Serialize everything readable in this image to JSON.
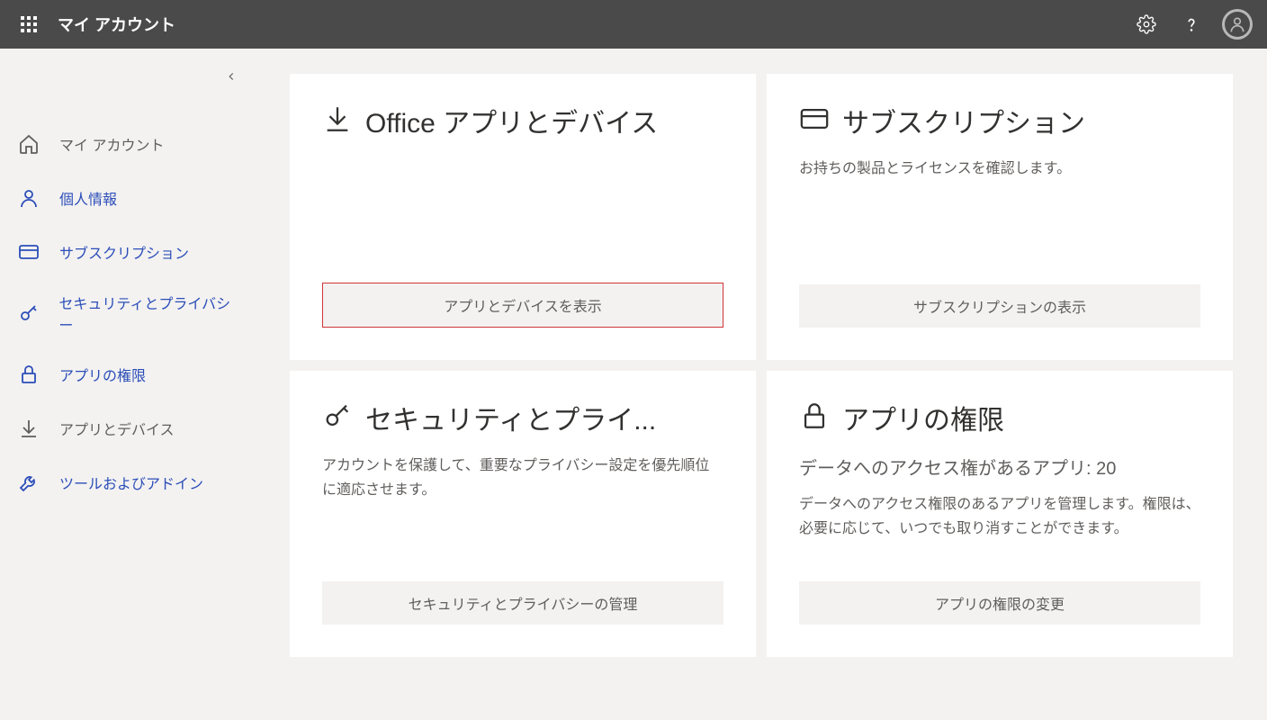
{
  "header": {
    "title": "マイ アカウント"
  },
  "sidebar": {
    "items": [
      {
        "label": "マイ アカウント",
        "link": false
      },
      {
        "label": "個人情報",
        "link": true
      },
      {
        "label": "サブスクリプション",
        "link": true
      },
      {
        "label": "セキュリティとプライバシー",
        "link": true
      },
      {
        "label": "アプリの権限",
        "link": true
      },
      {
        "label": "アプリとデバイス",
        "link": false
      },
      {
        "label": "ツールおよびアドイン",
        "link": true
      }
    ]
  },
  "cards": {
    "office": {
      "title": "Office アプリとデバイス",
      "button": "アプリとデバイスを表示"
    },
    "subscription": {
      "title": "サブスクリプション",
      "desc": "お持ちの製品とライセンスを確認します。",
      "button": "サブスクリプションの表示"
    },
    "security": {
      "title": "セキュリティとプライ...",
      "desc": "アカウントを保護して、重要なプライバシー設定を優先順位に適応させます。",
      "button": "セキュリティとプライバシーの管理"
    },
    "permissions": {
      "title": "アプリの権限",
      "access_count": "データへのアクセス権があるアプリ: 20",
      "desc": "データへのアクセス権限のあるアプリを管理します。権限は、必要に応じて、いつでも取り消すことができます。",
      "button": "アプリの権限の変更"
    }
  }
}
